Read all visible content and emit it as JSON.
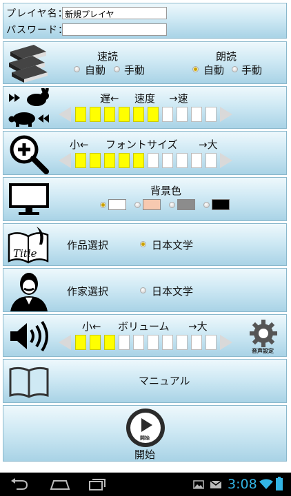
{
  "player": {
    "name_label": "プレイヤ名：",
    "name_value": "新規プレイヤ",
    "password_label": "パスワード：",
    "password_value": ""
  },
  "read_mode": {
    "speed_title": "速読",
    "speed_auto": "自動",
    "speed_manual": "手動",
    "speed_selected": "manual",
    "voice_title": "朗読",
    "voice_auto": "自動",
    "voice_manual": "手動",
    "voice_selected": "auto"
  },
  "speed": {
    "slow": "遅←",
    "label": "速度",
    "fast": "→速",
    "level": 6,
    "max": 10
  },
  "font": {
    "small": "小←",
    "label": "フォントサイズ",
    "large": "→大",
    "level": 5,
    "max": 10
  },
  "background": {
    "label": "背景色",
    "colors": [
      "#ffffff",
      "#f7c9b0",
      "#8c8c8c",
      "#000000"
    ],
    "selected": 0
  },
  "work": {
    "label": "作品選択",
    "value": "日本文学"
  },
  "author": {
    "label": "作家選択",
    "value": "日本文学"
  },
  "volume": {
    "small": "小←",
    "label": "ボリューム",
    "large": "→大",
    "level": 3,
    "max": 10,
    "settings_label": "音声設定"
  },
  "manual": {
    "label": "マニュアル"
  },
  "start": {
    "icon_label": "開始",
    "label": "開始"
  },
  "status": {
    "time": "3:08"
  },
  "icons": [
    "books-icon",
    "rabbit-icon",
    "turtle-icon",
    "zoom-in-icon",
    "monitor-icon",
    "title-book-icon",
    "author-portrait-icon",
    "speaker-icon",
    "gear-icon",
    "open-book-icon",
    "play-icon",
    "back-icon",
    "home-icon",
    "recent-apps-icon",
    "image-icon",
    "mail-icon",
    "wifi-icon",
    "battery-icon"
  ]
}
